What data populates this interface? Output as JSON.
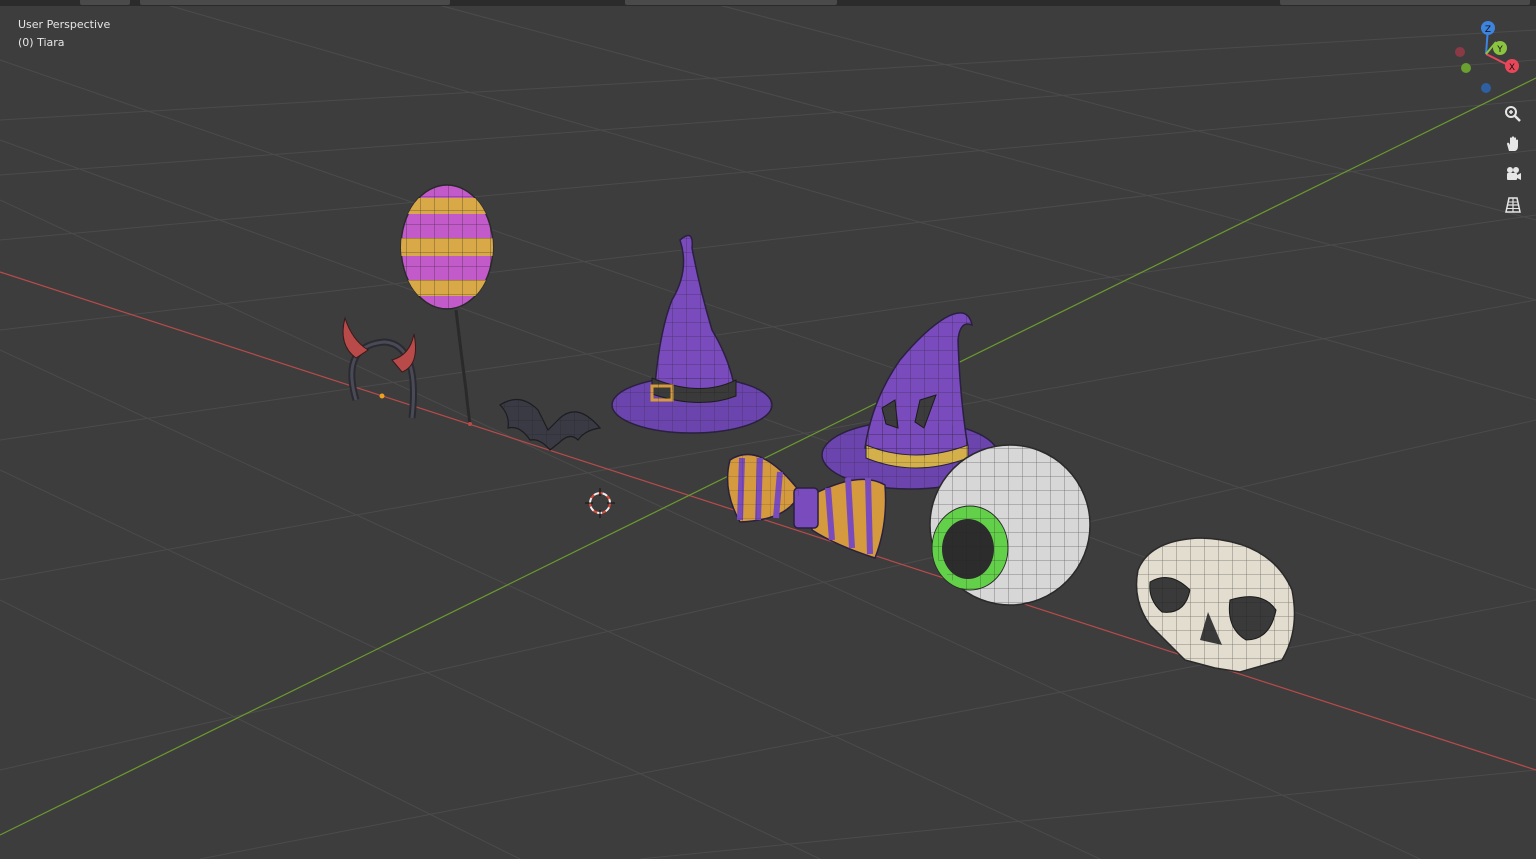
{
  "viewport": {
    "view_name": "User Perspective",
    "active_object": "(0) Tiara"
  },
  "gizmo": {
    "axes": {
      "x": "X",
      "y": "Y",
      "z": "Z"
    },
    "colors": {
      "x": "#e8475a",
      "y": "#8bc540",
      "z": "#3d84e0"
    }
  },
  "nav_tools": [
    {
      "name": "zoom-icon"
    },
    {
      "name": "pan-hand-icon"
    },
    {
      "name": "camera-view-icon"
    },
    {
      "name": "orthographic-grid-icon"
    }
  ],
  "scene_objects": [
    "devil-horns-headband",
    "striped-balloon",
    "bat",
    "witch-hat-tall",
    "witch-hat-eyes",
    "striped-bow-tie",
    "eyeball",
    "skull-mask",
    "3d-cursor"
  ],
  "colors": {
    "background": "#3d3d3d",
    "grid": "#4a4a4a",
    "x_axis_line": "#b84b4b",
    "y_axis_line": "#6b9a2f",
    "purple": "#7a4bbd",
    "orange": "#d49a3d",
    "pink": "#c25ac9",
    "green": "#63d04a",
    "bone": "#e3ddd0"
  }
}
